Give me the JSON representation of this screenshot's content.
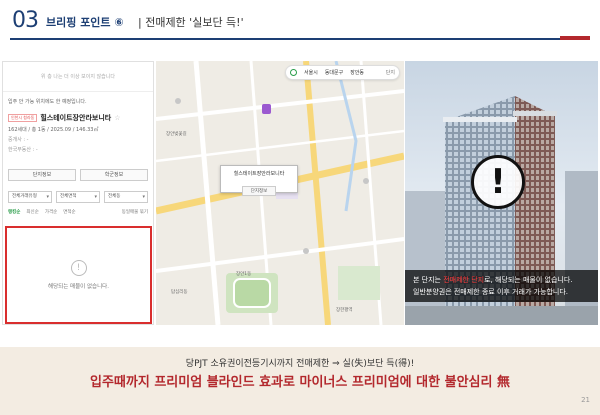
{
  "header": {
    "number": "03",
    "title": "브리핑 포인트 ⑥",
    "subtitle": "| 전매제한 '실보단 득!'"
  },
  "listing": {
    "top_notice": "위 층 나는 더 이상 보이지 않습니다",
    "notice_row": "입주 안 가능 위치에도 한 예정입니다.",
    "badge": "인천시 청라동",
    "name": "힐스테이트장안라보니타",
    "star": "☆",
    "detail": "162세대 / 총 1동 / 2025.09 / 146.33㎡",
    "sub1": "중개사 : -",
    "sub2": "한국부동산 : -",
    "buttons": [
      "단지정보",
      "학군정보"
    ],
    "filters": [
      "전체거래유형",
      "전체면적",
      "전체동"
    ],
    "tabs": [
      "랭킹순",
      "최신순",
      "가격순",
      "면적순"
    ],
    "tab_right": "동일매물 묶기",
    "empty_message": "해당되는 매물이 없습니다."
  },
  "map": {
    "location": [
      "서울시",
      "동대문구",
      "장안동"
    ],
    "location_action": "단지",
    "popup_title": "힐스테이트장안라보니타",
    "popup_button": "단지정보",
    "labels": [
      "장안벚꽃길",
      "장안1동",
      "장한평역",
      "답십리동"
    ]
  },
  "photo": {
    "caption_line1_a": "본 단지는 ",
    "caption_highlight": "전매제한 단지",
    "caption_line1_b": "로, 해당되는 매물이 없습니다.",
    "caption_line2": "일반분양권은 전매제한 종료 이후 거래가 가능합니다."
  },
  "bottom": {
    "line1": "당PJT 소유권이전등기시까지 전매제한 ⇒ 실(失)보단 득(得)!",
    "line2": "입주때까지 프리미엄 블라인드 효과로 마이너스 프리미엄에 대한 불안심리 無",
    "page": "21"
  }
}
